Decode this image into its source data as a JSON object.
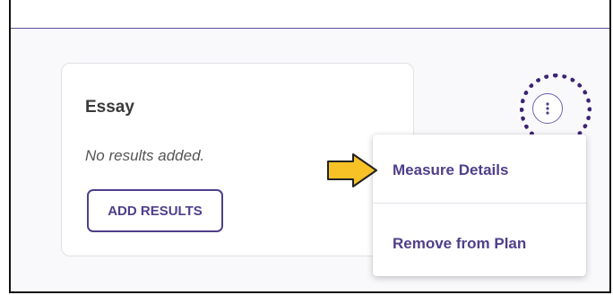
{
  "card": {
    "title": "Essay",
    "empty_text": "No results added.",
    "add_button_label": "ADD RESULTS",
    "menu_icon": "kebab-vertical-icon"
  },
  "menu": {
    "items": [
      {
        "label": "Measure Details"
      },
      {
        "label": "Remove from Plan"
      }
    ]
  },
  "annotations": {
    "arrow_icon": "pointer-arrow-icon",
    "arrow_color": "#f6c226",
    "circle_color": "#3c2473"
  },
  "colors": {
    "accent": "#4f3f8a"
  }
}
